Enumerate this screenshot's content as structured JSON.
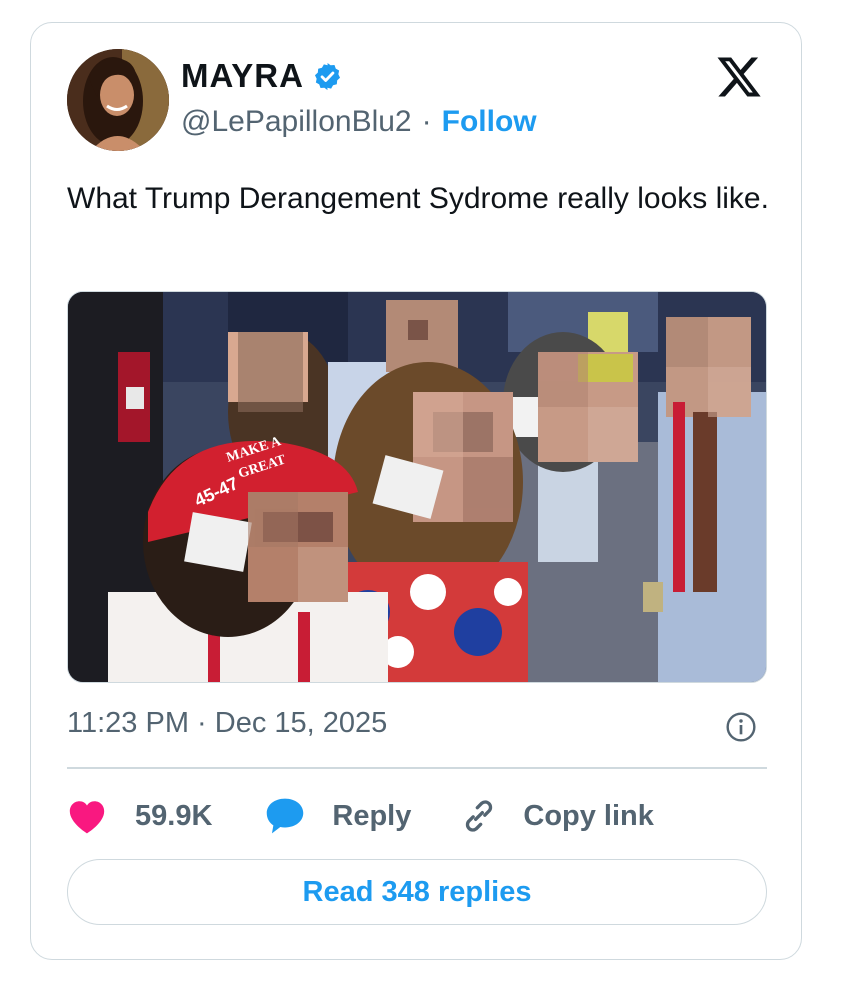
{
  "author": {
    "display_name": "MAYRA",
    "handle": "@LePapillonBlu2",
    "separator": "·",
    "follow_label": "Follow"
  },
  "tweet": {
    "text": "What Trump Derangement Sydrome really looks like."
  },
  "media": {
    "hat_text_1": "MAKE A",
    "hat_text_2": "GREAT",
    "hat_text_3": "45-47"
  },
  "meta": {
    "timestamp": "11:23 PM · Dec 15, 2025"
  },
  "actions": {
    "likes_count": "59.9K",
    "reply_label": "Reply",
    "copy_link_label": "Copy link"
  },
  "footer": {
    "read_replies_label": "Read 348 replies"
  },
  "icons": [
    "verified-badge-icon",
    "x-logo-icon",
    "info-icon",
    "heart-icon",
    "reply-bubble-icon",
    "link-icon"
  ],
  "colors": {
    "accent": "#1d9bf0",
    "heart": "#f91880",
    "muted": "#536471",
    "border": "#cfd9de"
  }
}
